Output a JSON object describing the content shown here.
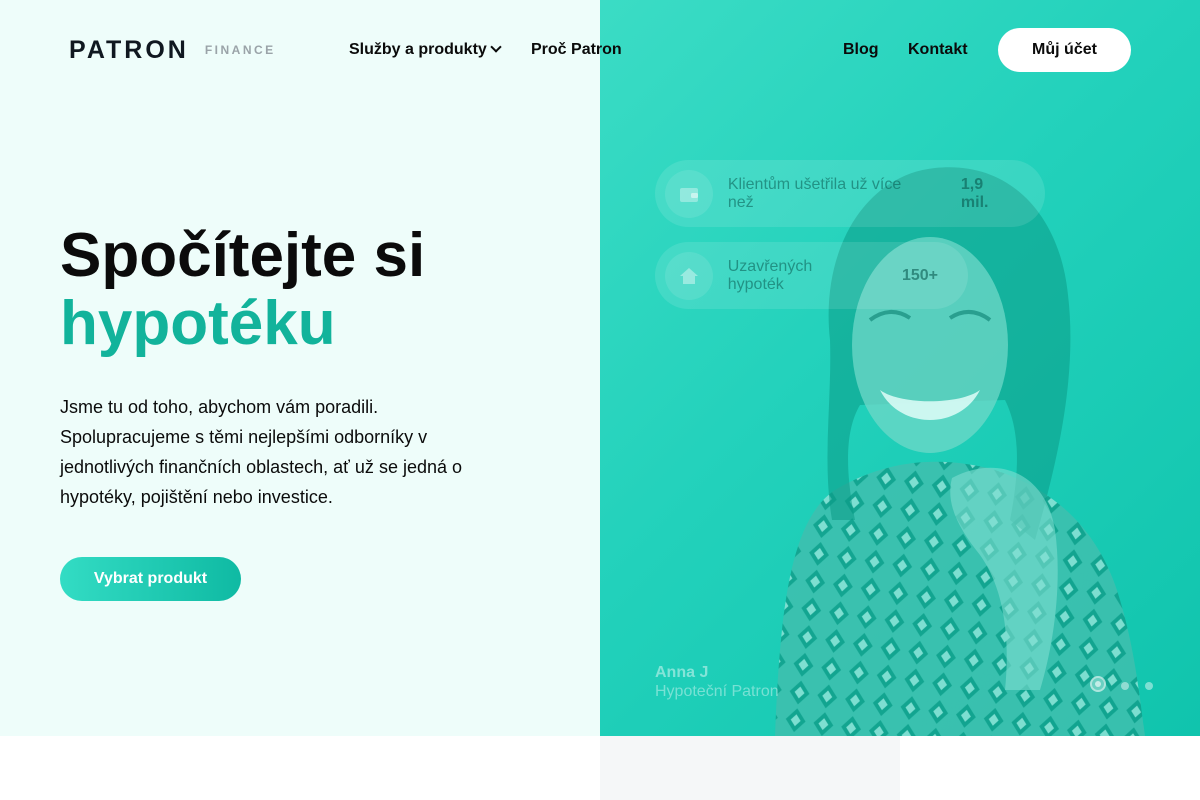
{
  "brand": {
    "logo_main": "PATRON",
    "logo_sub": "FINANCE"
  },
  "nav": {
    "services_label": "Služby a produkty",
    "why_label": "Proč Patron",
    "blog_label": "Blog",
    "contact_label": "Kontakt",
    "account_label": "Můj účet"
  },
  "hero": {
    "title_line1": "Spočítejte si",
    "title_line2": "hypotéku",
    "description": "Jsme tu od toho, abychom vám poradili. Spolupracujeme s těmi nejlepšími odborníky v jednotlivých finančních oblastech, ať už se jedná o hypotéky, pojištění nebo investice.",
    "cta_label": "Vybrat produkt"
  },
  "stats": [
    {
      "icon": "wallet-icon",
      "label": "Klientům ušetřila už více než",
      "value": "1,9 mil."
    },
    {
      "icon": "home-icon",
      "label": "Uzavřených hypoték",
      "value": "150+"
    }
  ],
  "person": {
    "name": "Anna J",
    "role": "Hypoteční Patron"
  },
  "carousel": {
    "slide_count": 3,
    "active_index": 0
  },
  "colors": {
    "accent": "#12b39b",
    "panel": "#22d1bb",
    "light_bg": "#eefdfa"
  }
}
